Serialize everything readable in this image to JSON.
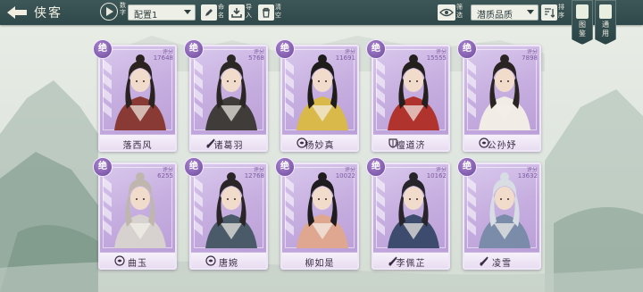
{
  "header": {
    "title": "侠客",
    "mini_label": "数字",
    "config_select": "配置1",
    "tools": [
      {
        "label": "命名",
        "icon": "pencil-icon"
      },
      {
        "label": "导入",
        "icon": "import-icon"
      },
      {
        "label": "清空",
        "icon": "trash-icon"
      }
    ],
    "filter_label": "筛选",
    "sort_select": "潜质品质",
    "sort_label": "排序",
    "side_buttons": [
      {
        "label": "图鉴",
        "icon": "book-icon"
      },
      {
        "label": "通用",
        "icon": "scroll-icon"
      }
    ]
  },
  "cards": [
    {
      "name": "落西风",
      "grade": "绝",
      "score_label": "评分",
      "score": "17648",
      "weapon": "none"
    },
    {
      "name": "诸葛羽",
      "grade": "绝",
      "score_label": "评分",
      "score": "5768",
      "weapon": "sword-icon"
    },
    {
      "name": "杨妙真",
      "grade": "绝",
      "score_label": "评分",
      "score": "11691",
      "weapon": "fist-icon"
    },
    {
      "name": "檀道济",
      "grade": "绝",
      "score_label": "评分",
      "score": "15555",
      "weapon": "shield-icon"
    },
    {
      "name": "公孙妤",
      "grade": "绝",
      "score_label": "评分",
      "score": "7898",
      "weapon": "fist-icon"
    },
    {
      "name": "曲玉",
      "grade": "绝",
      "score_label": "评分",
      "score": "6255",
      "weapon": "fist-icon"
    },
    {
      "name": "唐婉",
      "grade": "绝",
      "score_label": "评分",
      "score": "12768",
      "weapon": "fist-icon"
    },
    {
      "name": "柳如是",
      "grade": "绝",
      "score_label": "评分",
      "score": "10022",
      "weapon": "none"
    },
    {
      "name": "李佩芷",
      "grade": "绝",
      "score_label": "评分",
      "score": "10162",
      "weapon": "sword-icon"
    },
    {
      "name": "凌雪",
      "grade": "绝",
      "score_label": "评分",
      "score": "13632",
      "weapon": "sword-icon"
    }
  ],
  "colors": {
    "topbar": "#2f4849",
    "card_purple": "#c6aee0",
    "badge_purple": "#6e4a9c"
  }
}
